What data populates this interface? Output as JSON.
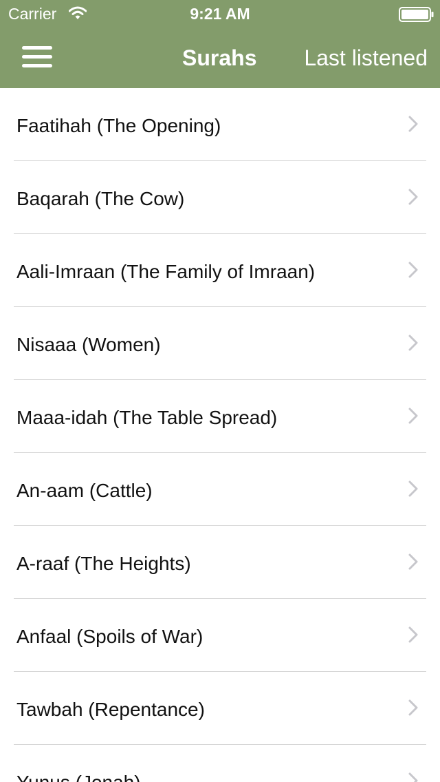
{
  "status_bar": {
    "carrier": "Carrier",
    "time": "9:21 AM",
    "wifi_icon": "wifi-icon",
    "battery_icon": "battery-icon"
  },
  "nav_bar": {
    "menu_icon": "hamburger-menu-icon",
    "title": "Surahs",
    "right_button": "Last listened",
    "background_color": "#839c6b",
    "text_color": "#ffffff"
  },
  "surahs": [
    {
      "label": "Faatihah (The Opening)"
    },
    {
      "label": "Baqarah (The Cow)"
    },
    {
      "label": "Aali-Imraan (The Family of Imraan)"
    },
    {
      "label": "Nisaaa (Women)"
    },
    {
      "label": "Maaa-idah (The Table Spread)"
    },
    {
      "label": "An-aam (Cattle)"
    },
    {
      "label": "A-raaf (The Heights)"
    },
    {
      "label": "Anfaal (Spoils of War)"
    },
    {
      "label": "Tawbah (Repentance)"
    },
    {
      "label": "Yunus (Jonah)"
    }
  ],
  "row_icon": "chevron-right-icon"
}
